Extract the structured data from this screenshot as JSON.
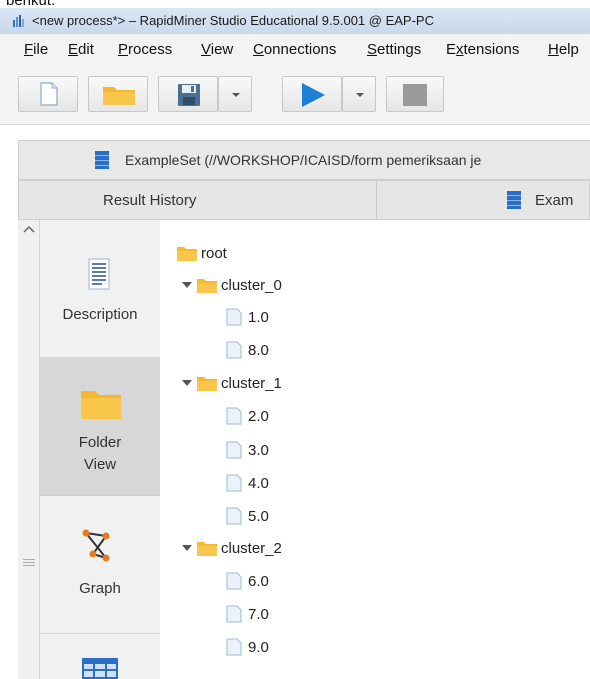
{
  "cropped_top_text": "berikut:",
  "window": {
    "title": "<new process*> – RapidMiner Studio Educational 9.5.001 @ EAP-PC"
  },
  "menubar": {
    "items": [
      {
        "label": "File",
        "key": "F"
      },
      {
        "label": "Edit",
        "key": "E"
      },
      {
        "label": "Process",
        "key": "P"
      },
      {
        "label": "View",
        "key": "V"
      },
      {
        "label": "Connections",
        "key": "C"
      },
      {
        "label": "Settings",
        "key": "S"
      },
      {
        "label": "Extensions",
        "key": "x"
      },
      {
        "label": "Help",
        "key": "H"
      }
    ]
  },
  "toolbar": {
    "buttons": [
      "new-process-icon",
      "open-folder-icon",
      "save-icon",
      "dropdown-arrow-icon",
      "run-play-icon",
      "dropdown-arrow-icon",
      "stop-icon"
    ]
  },
  "tabs": {
    "exampleset_tab": "ExampleSet (//WORKSHOP/ICAISD/form pemeriksaan je",
    "result_history": "Result History",
    "example_tab2": "Exam"
  },
  "views": {
    "description": "Description",
    "folder_view_1": "Folder",
    "folder_view_2": "View",
    "graph": "Graph"
  },
  "tree": {
    "root": "root",
    "clusters": [
      {
        "name": "cluster_0",
        "items": [
          "1.0",
          "8.0"
        ]
      },
      {
        "name": "cluster_1",
        "items": [
          "2.0",
          "3.0",
          "4.0",
          "5.0"
        ]
      },
      {
        "name": "cluster_2",
        "items": [
          "6.0",
          "7.0",
          "9.0"
        ]
      }
    ]
  },
  "colors": {
    "folder": "#f5b82e",
    "play": "#1e7fd8",
    "accent_icon": "#2a6fc4"
  }
}
